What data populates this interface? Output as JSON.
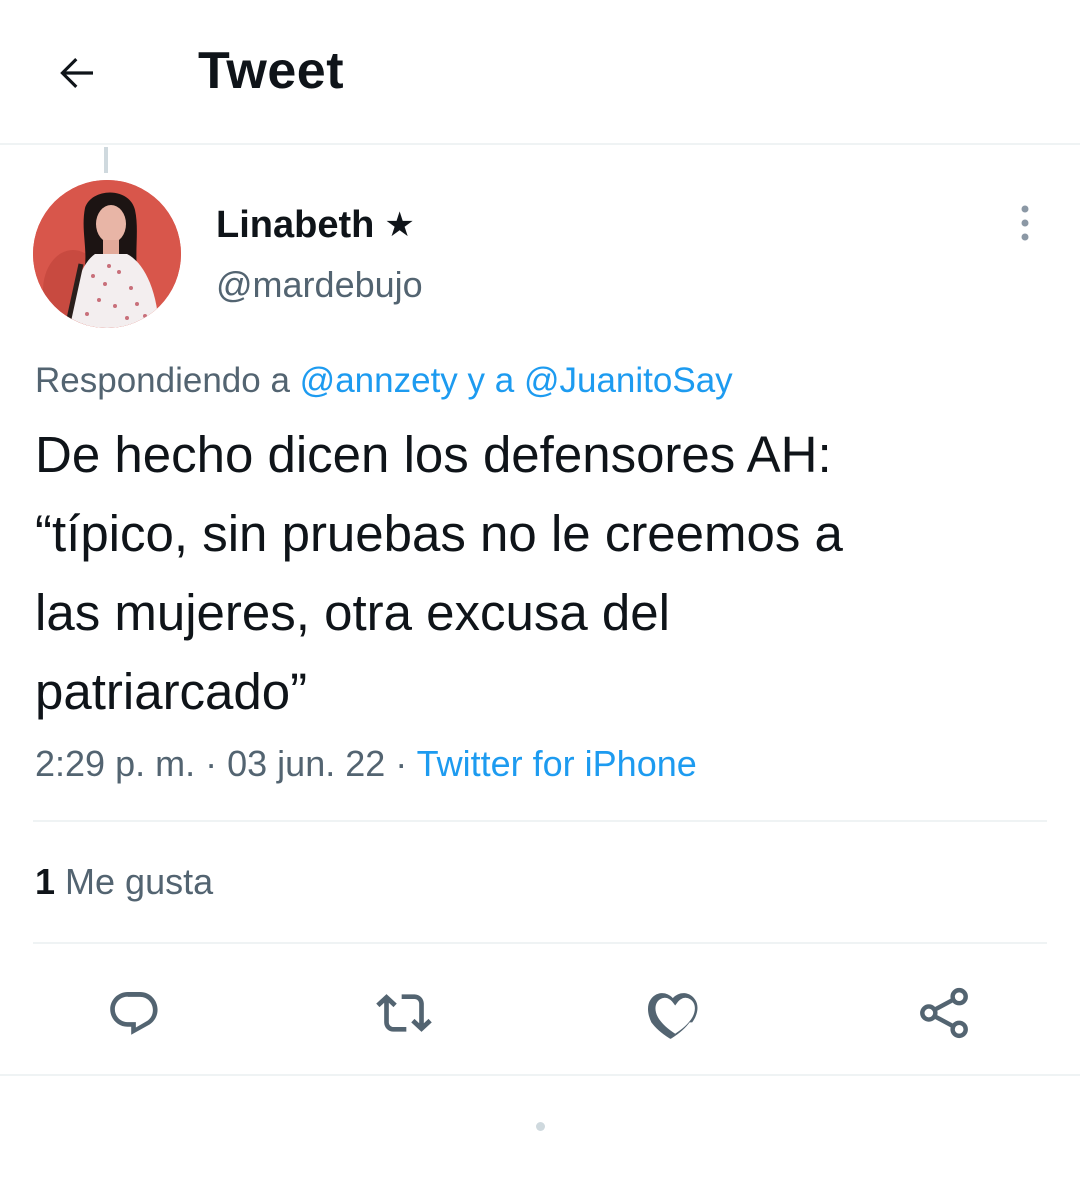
{
  "header": {
    "title": "Tweet",
    "back_icon": "arrow-left-icon"
  },
  "tweet": {
    "author": {
      "display_name": "Linabeth",
      "badge_glyph": "★",
      "handle": "@mardebujo"
    },
    "reply_context": {
      "prefix": "Respondiendo a",
      "mention_1": "@annzety",
      "connector": "y a",
      "mention_2": "@JuanitoSay"
    },
    "text": "De hecho dicen los defensores AH:\n“típico, sin pruebas no le creemos a\nlas mujeres, otra excusa del\npatriarcado”",
    "time": "2:29 p. m.",
    "separator": "·",
    "date": "03 jun. 22",
    "source": "Twitter for iPhone",
    "likes": {
      "count": "1",
      "label": "Me gusta"
    }
  },
  "actions": {
    "reply_icon": "reply-icon",
    "retweet_icon": "retweet-icon",
    "like_icon": "heart-icon",
    "share_icon": "share-icon"
  },
  "colors": {
    "link": "#1d9bf0",
    "secondary_text": "#536471",
    "primary_text": "#0f1419",
    "divider": "#eff3f4"
  }
}
